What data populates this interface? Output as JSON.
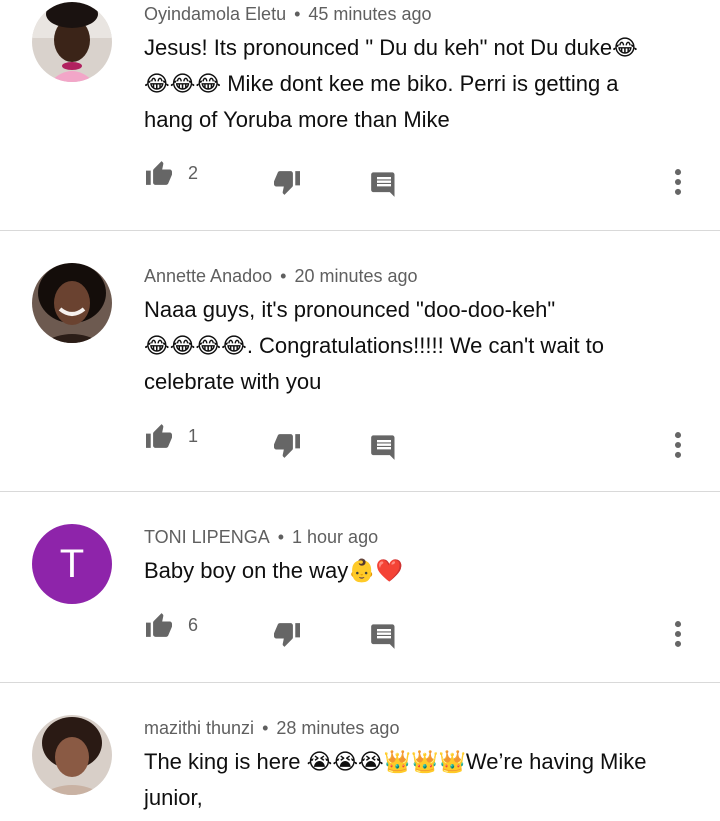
{
  "comments": [
    {
      "author": "Oyindamola Eletu",
      "time": "45 minutes ago",
      "lines": [
        "Jesus! Its pronounced \" Du du keh\" not Du duke😂",
        "😂😂😂 Mike dont kee me biko. Perri is getting a",
        "hang of Yoruba more than Mike"
      ],
      "likes": "2",
      "avatar_color": "#c7b8a6"
    },
    {
      "author": "Annette Anadoo",
      "time": "20 minutes ago",
      "lines": [
        "Naaa guys, it's pronounced \"doo-doo-keh\"",
        "😂😂😂😂. Congratulations!!!!! We can't wait to",
        "celebrate with you"
      ],
      "likes": "1",
      "avatar_color": "#3a2a22"
    },
    {
      "author": "TONI LIPENGA",
      "time": "1 hour ago",
      "lines": [
        "Baby boy on the way👶❤️"
      ],
      "likes": "6",
      "avatar_initial": "T",
      "avatar_color": "#8e24aa"
    },
    {
      "author": "mazithi thunzi",
      "time": "28 minutes ago",
      "lines": [
        "The king is here 😭😭😭👑👑👑We’re having Mike",
        "junior,"
      ],
      "avatar_color": "#b89b86"
    }
  ],
  "separator": "•",
  "icons": {
    "like": "thumb-up-icon",
    "dislike": "thumb-down-icon",
    "reply": "reply-comment-icon",
    "more": "more-vert-icon"
  }
}
